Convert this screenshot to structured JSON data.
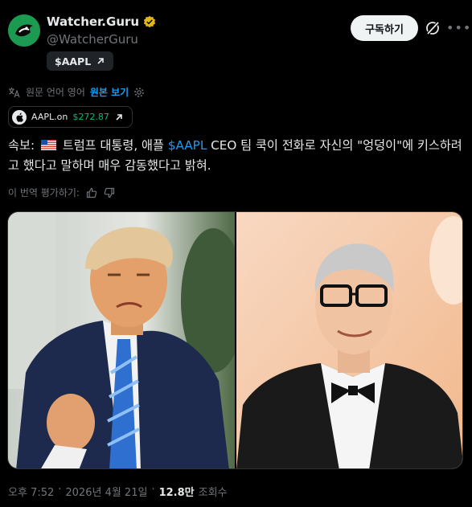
{
  "tweet": {
    "author_name": "Watcher.Guru",
    "handle": "@WatcherGuru",
    "cashtag_chip": "$AAPL",
    "subscribe_label": "구독하기",
    "translation": {
      "original_language_label": "원문 언어 영어",
      "show_original_label": "원본 보기"
    },
    "stock": {
      "ticker": "AAPL.on",
      "price": "$272.87"
    },
    "text": {
      "prefix": "속보: ",
      "before_cashtag": " 트럼프 대통령, 애플 ",
      "cashtag": "$AAPL",
      "after_cashtag": " CEO 팀 쿡이 전화로 자신의 \"엉덩이\"에 키스하려고 했다고 말하며 매우 감동했다고 밝혀."
    },
    "rate_translation_label": "이 번역 평가하기:",
    "meta": {
      "time": "오후 7:52",
      "separator": "·",
      "date": "2026년 4월 21일",
      "views": "12.8만",
      "views_label": "조회수"
    }
  },
  "colors": {
    "background": "#000000",
    "accent_blue": "#1d9bf0",
    "price_green": "#00ba7c",
    "verified_gold": "#e2b719",
    "avatar_green": "#1d9a52"
  },
  "icons": [
    "verified-badge-icon",
    "arrow-up-right-icon",
    "gear-icon",
    "apple-logo-icon",
    "us-flag-icon",
    "thumbs-up-icon",
    "thumbs-down-icon",
    "grok-icon",
    "more-icon"
  ]
}
